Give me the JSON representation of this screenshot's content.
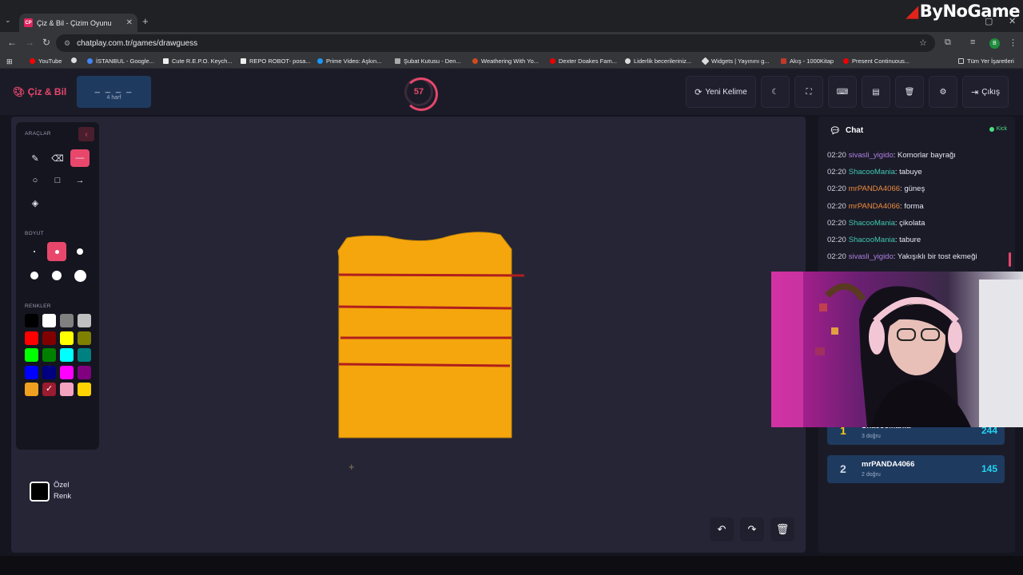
{
  "browser": {
    "tab_title": "Çiz & Bil - Çizim Oyunu",
    "tab_favicon": "CP",
    "url": "chatplay.com.tr/games/drawguess",
    "profile_initial": "B",
    "bookmarks": [
      "YouTube",
      "İSTANBUL - Google...",
      "Cute R.E.P.O. Keych...",
      "REPO ROBOT- posa...",
      "Prime Video: Aşkın...",
      "Şubat Kutusu - Den...",
      "Weathering With Yo...",
      "Dexter Doakes Fam...",
      "Liderlik becerileriniz...",
      "Widgets | Yayınını g...",
      "Akış - 1000Kitap",
      "Present Continuous..."
    ],
    "all_bookmarks": "Tüm Yer İşaretleri"
  },
  "overlay": {
    "brand": "ByNoGame"
  },
  "app": {
    "logo": "Çiz & Bil",
    "word_blanks": "_ _ _ _",
    "word_hint": "4 harf",
    "timer": "57",
    "new_word_label": "Yeni Kelime",
    "exit_label": "Çıkış"
  },
  "tools": {
    "section_tools": "ARAÇLAR",
    "section_size": "BOYUT",
    "section_colors": "RENKLER",
    "custom_color": "Özel Renk",
    "active_tool": "line",
    "active_size": 2,
    "selected_color": "#9b1b30",
    "colors": [
      "#000000",
      "#ffffff",
      "#808080",
      "#c0c0c0",
      "#ff0000",
      "#800000",
      "#ffff00",
      "#808000",
      "#00ff00",
      "#008000",
      "#00ffff",
      "#008080",
      "#0000ff",
      "#000080",
      "#ff00ff",
      "#800080",
      "#f0a020",
      "#9b1b30",
      "#f4a3c0",
      "#ffd400"
    ]
  },
  "drawing": {
    "fill_color": "#f5a60c",
    "stripe_color": "#b01e1e"
  },
  "chat": {
    "title": "Chat",
    "platform": "Kick",
    "messages": [
      {
        "time": "02:20",
        "user": "sivasli_yigido",
        "color": "#b07fe0",
        "text": "Komorlar bayrağı"
      },
      {
        "time": "02:20",
        "user": "ShacooMania",
        "color": "#3fc9b0",
        "text": "tabuye"
      },
      {
        "time": "02:20",
        "user": "mrPANDA4066",
        "color": "#f08c3c",
        "text": "güneş"
      },
      {
        "time": "02:20",
        "user": "mrPANDA4066",
        "color": "#f08c3c",
        "text": "forma"
      },
      {
        "time": "02:20",
        "user": "ShacooMania",
        "color": "#3fc9b0",
        "text": "çikolata"
      },
      {
        "time": "02:20",
        "user": "ShacooMania",
        "color": "#3fc9b0",
        "text": "tabure"
      },
      {
        "time": "02:20",
        "user": "sivasli_yigido",
        "color": "#b07fe0",
        "text": "Yakışıklı bir tost ekmeği"
      }
    ]
  },
  "scores": [
    {
      "rank": "1",
      "rank_color": "#facc15",
      "name": "ShacooMania",
      "correct": "3 doğru",
      "points": "244"
    },
    {
      "rank": "2",
      "rank_color": "#cfd8e6",
      "name": "mrPANDA4066",
      "correct": "2 doğru",
      "points": "145"
    }
  ]
}
